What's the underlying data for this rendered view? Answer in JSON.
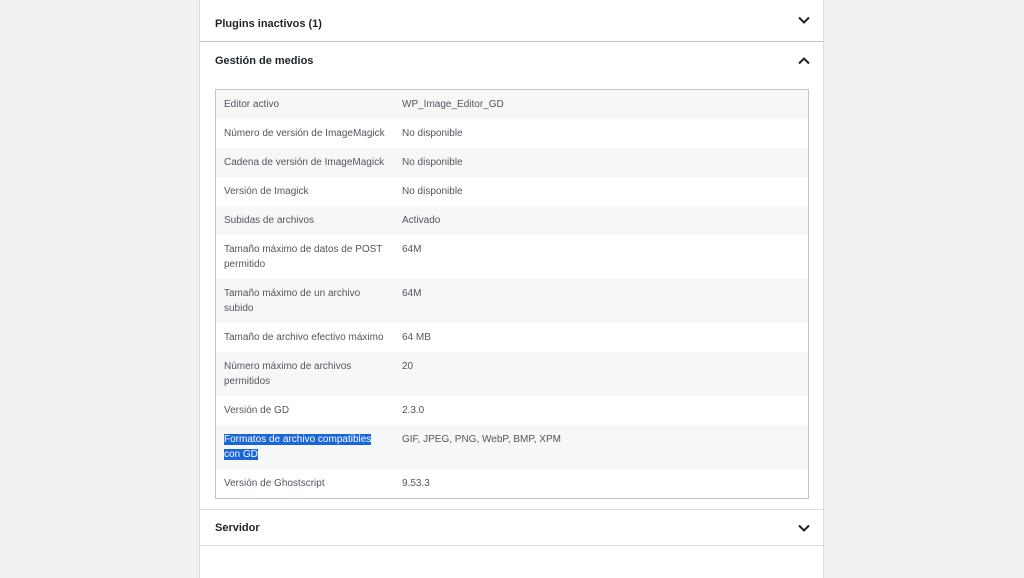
{
  "sections": {
    "plugins_inactive": {
      "title": "Plugins inactivos (1)",
      "expanded": false
    },
    "media": {
      "title": "Gestión de medios",
      "expanded": true
    },
    "server": {
      "title": "Servidor",
      "expanded": false
    }
  },
  "media_rows": [
    {
      "key": "Editor activo",
      "value": "WP_Image_Editor_GD"
    },
    {
      "key": "Número de versión de ImageMagick",
      "value": "No disponible"
    },
    {
      "key": "Cadena de versión de ImageMagick",
      "value": "No disponible"
    },
    {
      "key": "Versión de Imagick",
      "value": "No disponible"
    },
    {
      "key": "Subidas de archivos",
      "value": "Activado"
    },
    {
      "key": "Tamaño máximo de datos de POST permitido",
      "value": "64M"
    },
    {
      "key": "Tamaño máximo de un archivo subido",
      "value": "64M"
    },
    {
      "key": "Tamaño de archivo efectivo máximo",
      "value": "64 MB"
    },
    {
      "key": "Número máximo de archivos permitidos",
      "value": "20"
    },
    {
      "key": "Versión de GD",
      "value": "2.3.0"
    },
    {
      "key": "Formatos de archivo compatibles con GD",
      "value": "GIF, JPEG, PNG, WebP, BMP, XPM",
      "selected": true
    },
    {
      "key": "Versión de Ghostscript",
      "value": "9.53.3"
    }
  ],
  "icons": {
    "collapsed": "chevron-down-icon",
    "expanded": "chevron-up-icon"
  },
  "colors": {
    "selection": "#1a66d9",
    "page_bg": "#f0f0f1",
    "panel_bg": "#ffffff"
  }
}
